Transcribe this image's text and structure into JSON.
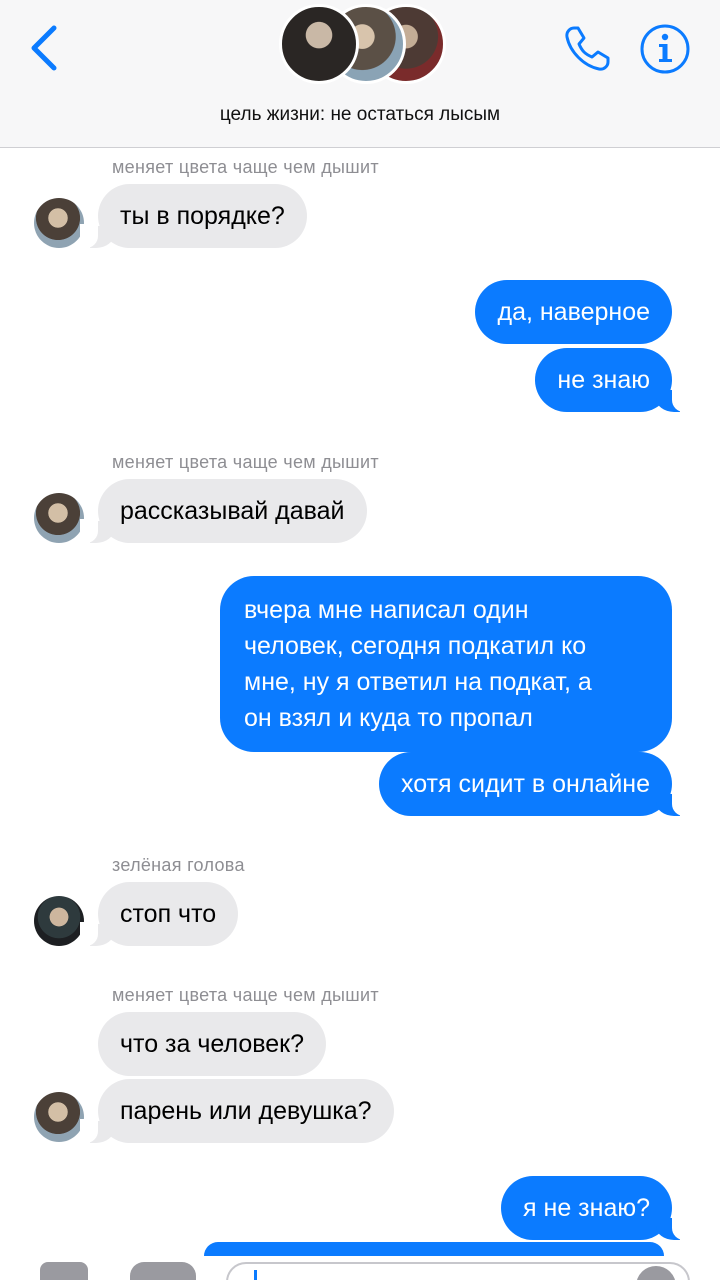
{
  "header": {
    "group_title": "цель жизни: не остаться лысым",
    "icons": [
      "chevron-left-icon",
      "phone-icon",
      "info-icon"
    ],
    "accent_color": "#0b7bff"
  },
  "messages": [
    {
      "sender": "меняет цвета чаще чем дышит",
      "text": "ты в порядке?"
    },
    {
      "text": "да, наверное"
    },
    {
      "text": "не знаю"
    },
    {
      "sender": "меняет цвета чаще чем дышит",
      "text": "рассказывай давай"
    },
    {
      "lines": [
        "вчера мне написал один",
        "человек, сегодня подкатил ко",
        "мне, ну я ответил на подкат, а",
        "он взял и куда то пропал"
      ]
    },
    {
      "text": "хотя сидит в онлайне"
    },
    {
      "sender": "зелёная голова",
      "text": "стоп что"
    },
    {
      "sender": "меняет цвета чаще чем дышит",
      "text": "что за человек?"
    },
    {
      "text": "парень или девушка?"
    },
    {
      "text": "я не знаю?"
    }
  ],
  "colors": {
    "outgoing_bubble": "#0b7bff",
    "incoming_bubble": "#e9e9eb",
    "sender_label": "#8e8e93"
  }
}
